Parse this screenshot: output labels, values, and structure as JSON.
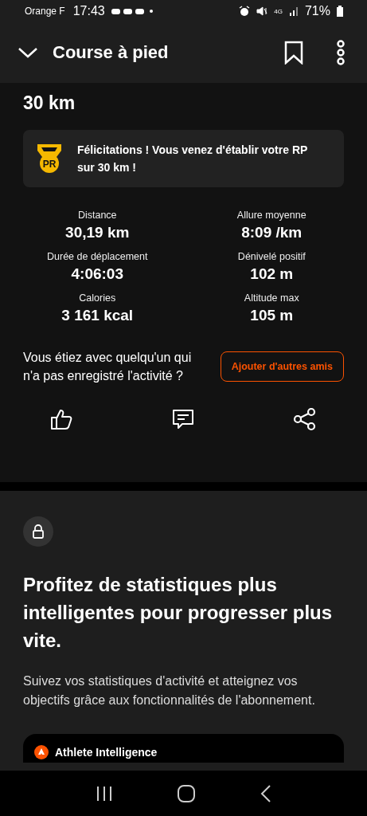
{
  "status_bar": {
    "carrier": "Orange F",
    "time": "17:43",
    "network": "4G",
    "battery": "71%"
  },
  "header": {
    "title": "Course à pied"
  },
  "activity": {
    "heading": "30 km",
    "achievement": {
      "text": "Félicitations ! Vous venez d'établir votre RP sur 30 km !",
      "badge": "PR"
    },
    "stats": [
      {
        "label": "Distance",
        "value": "30,19 km"
      },
      {
        "label": "Allure moyenne",
        "value": "8:09 /km"
      },
      {
        "label": "Durée de déplacement",
        "value": "4:06:03"
      },
      {
        "label": "Dénivelé positif",
        "value": "102 m"
      },
      {
        "label": "Calories",
        "value": "3 161 kcal"
      },
      {
        "label": "Altitude max",
        "value": "105 m"
      }
    ],
    "friends": {
      "prompt": "Vous étiez avec quelqu'un qui n'a pas enregistré l'activité ?",
      "button": "Ajouter d'autres amis"
    }
  },
  "promo": {
    "title": "Profitez de statistiques plus intelligentes pour progresser plus vite.",
    "body": "Suivez vos statistiques d'activité et atteignez vos objectifs grâce aux fonctionnalités de l'abonnement.",
    "card_title": "Athlete Intelligence"
  }
}
